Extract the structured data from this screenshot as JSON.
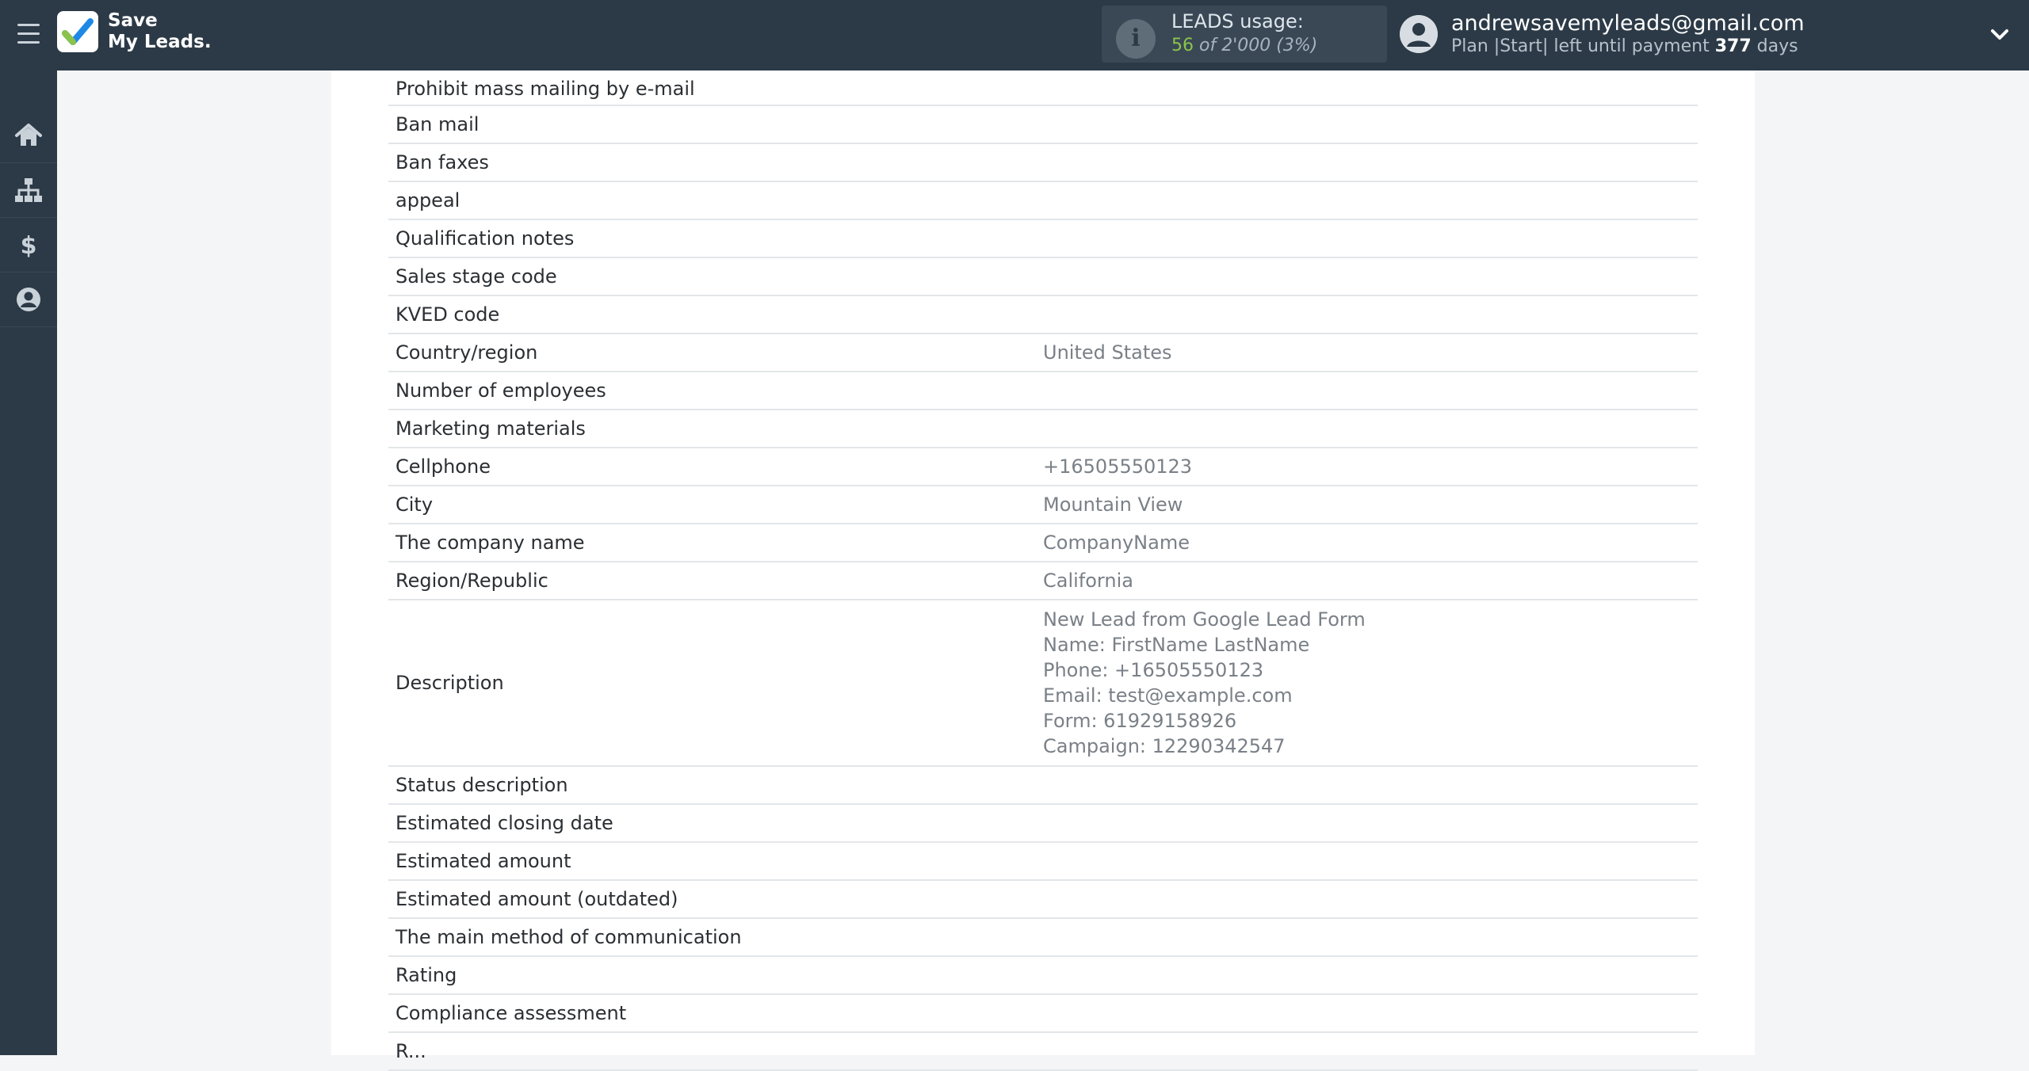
{
  "app": {
    "logo_line1": "Save",
    "logo_line2": "My Leads."
  },
  "usage": {
    "label": "LEADS usage:",
    "value": "56",
    "of_text": "of 2'000",
    "percent": "(3%)"
  },
  "user": {
    "email": "andrewsavemyleads@gmail.com",
    "plan_prefix": "Plan |Start| left until payment",
    "days": "377",
    "days_suffix": "days"
  },
  "sidebar": {
    "items": [
      {
        "icon": "home-icon"
      },
      {
        "icon": "sitemap-icon"
      },
      {
        "icon": "dollar-icon"
      },
      {
        "icon": "user-icon"
      }
    ]
  },
  "fields": [
    {
      "label": "Prohibit mass mailing by e-mail",
      "value": ""
    },
    {
      "label": "Ban mail",
      "value": ""
    },
    {
      "label": "Ban faxes",
      "value": ""
    },
    {
      "label": "appeal",
      "value": ""
    },
    {
      "label": "Qualification notes",
      "value": ""
    },
    {
      "label": "Sales stage code",
      "value": ""
    },
    {
      "label": "KVED code",
      "value": ""
    },
    {
      "label": "Country/region",
      "value": "United States"
    },
    {
      "label": "Number of employees",
      "value": ""
    },
    {
      "label": "Marketing materials",
      "value": ""
    },
    {
      "label": "Cellphone",
      "value": "+16505550123"
    },
    {
      "label": "City",
      "value": "Mountain View"
    },
    {
      "label": "The company name",
      "value": "CompanyName"
    },
    {
      "label": "Region/Republic",
      "value": "California"
    },
    {
      "label": "Description",
      "value_lines": [
        "New Lead from Google Lead Form",
        "Name: FirstName LastName",
        "Phone: +16505550123",
        "Email: test@example.com",
        "Form: 61929158926",
        "Campaign: 12290342547"
      ]
    },
    {
      "label": "Status description",
      "value": ""
    },
    {
      "label": "Estimated closing date",
      "value": ""
    },
    {
      "label": "Estimated amount",
      "value": ""
    },
    {
      "label": "Estimated amount (outdated)",
      "value": ""
    },
    {
      "label": "The main method of communication",
      "value": ""
    },
    {
      "label": "Rating",
      "value": ""
    },
    {
      "label": "Compliance assessment",
      "value": ""
    },
    {
      "label": "R...",
      "value": ""
    }
  ],
  "colors": {
    "topbar": "#2c3a47",
    "accent_green": "#8bc34a",
    "logo_blue": "#1e88e5"
  }
}
